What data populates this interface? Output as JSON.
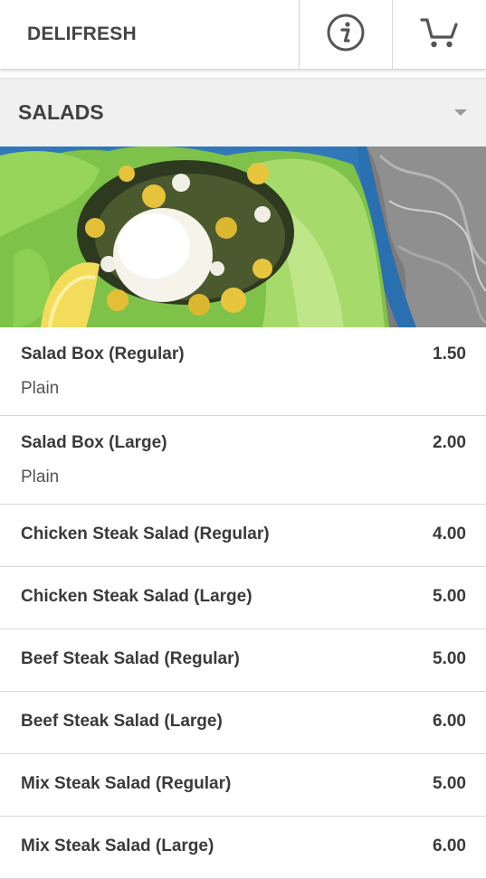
{
  "header": {
    "brand": "DELIFRESH",
    "info_icon": "info-icon",
    "cart_icon": "cart-icon"
  },
  "category": {
    "label": "SALADS",
    "dropdown_icon": "caret-down-icon"
  },
  "items": [
    {
      "name": "Salad Box (Regular)",
      "price": "1.50",
      "desc": "Plain"
    },
    {
      "name": "Salad Box (Large)",
      "price": "2.00",
      "desc": "Plain"
    },
    {
      "name": "Chicken Steak Salad (Regular)",
      "price": "4.00"
    },
    {
      "name": "Chicken Steak Salad (Large)",
      "price": "5.00"
    },
    {
      "name": "Beef Steak Salad (Regular)",
      "price": "5.00"
    },
    {
      "name": "Beef Steak Salad (Large)",
      "price": "6.00"
    },
    {
      "name": "Mix Steak Salad (Regular)",
      "price": "5.00"
    },
    {
      "name": "Mix Steak Salad (Large)",
      "price": "6.00"
    }
  ],
  "colors": {
    "header_bg": "#ffffff",
    "category_bg": "#f0f0f0",
    "text": "#3a3a3a",
    "divider": "#d8d8d8"
  }
}
